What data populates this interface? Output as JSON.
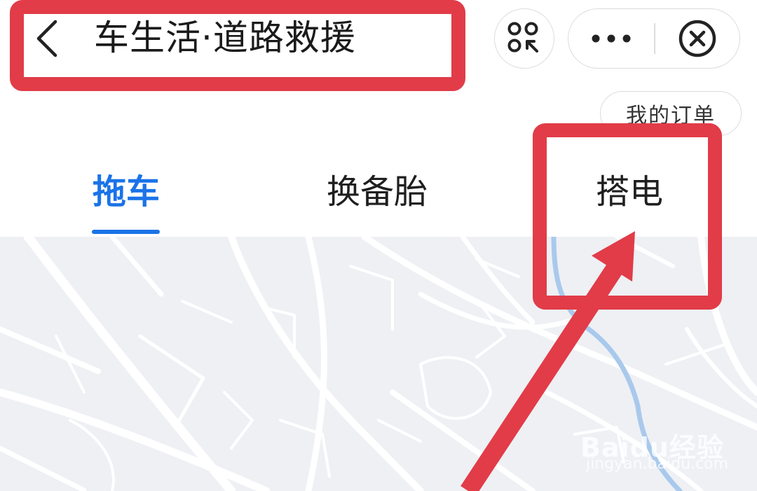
{
  "header": {
    "title": "车生活·道路救援",
    "back_icon": "chevron-left-icon",
    "scan_icon": "scan-code-icon",
    "more_icon": "more-dots-icon",
    "close_icon": "close-circle-icon"
  },
  "orders_button": {
    "label": "我的订单"
  },
  "tabs": [
    {
      "label": "拖车",
      "active": true
    },
    {
      "label": "换备胎",
      "active": false
    },
    {
      "label": "搭电",
      "active": false
    }
  ],
  "colors": {
    "accent": "#1a73e8",
    "annotation": "#e13c48",
    "map_background": "#eef0f4",
    "map_water": "#a9c9ec"
  },
  "watermark": {
    "brand": "Baidu经验",
    "url": "jingyan.baidu.com"
  }
}
